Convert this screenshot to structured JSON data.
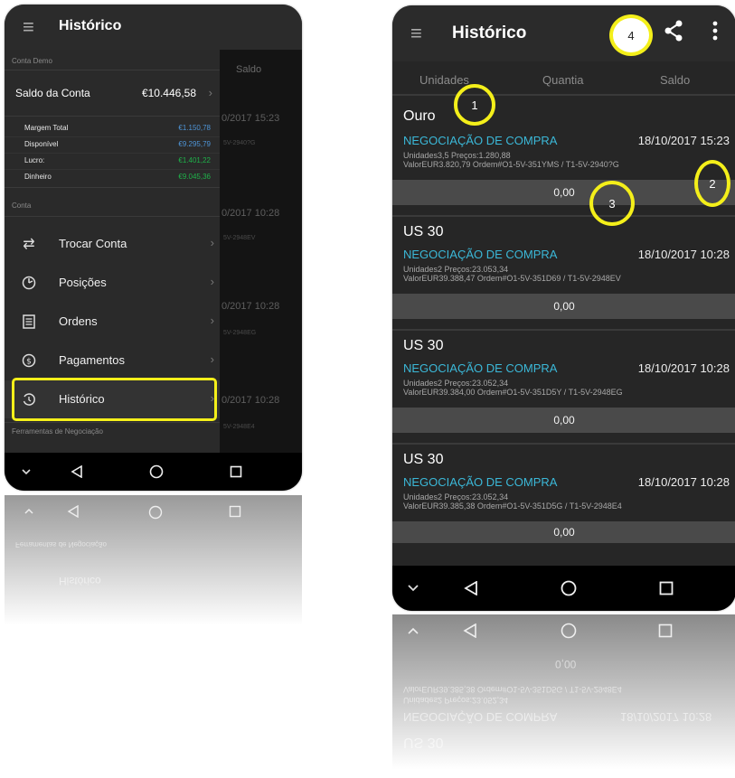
{
  "colors": {
    "accent_cyan": "#3bb8d8",
    "margin_blue": "#4e94d6",
    "green_value": "#1fb24a",
    "highlight_yellow": "#f4ef1a"
  },
  "left_phone": {
    "title": "Histórico",
    "section_demo": "Conta Demo",
    "background_header": "Saldo",
    "background_dates": [
      "0/2017 15:23",
      "0/2017 10:28",
      "0/2017 10:28",
      "0/2017 10:28"
    ],
    "background_codes": [
      "5V-2940?G",
      "5V-2948EV",
      "5V-2948EG",
      "5V-2948E4"
    ],
    "balance_label": "Saldo da Conta",
    "balance_value": "€10.446,58",
    "stats": [
      {
        "label": "Margem Total",
        "value": "€1.150,78"
      },
      {
        "label": "Disponível",
        "value": "€9.295,79"
      },
      {
        "label": "Lucro:",
        "value": "€1.401,22"
      },
      {
        "label": "Dinheiro",
        "value": "€9.045,36"
      }
    ],
    "section_account": "Conta",
    "menu": [
      {
        "icon": "swap-icon",
        "label": "Trocar Conta"
      },
      {
        "icon": "clock-icon",
        "label": "Posições"
      },
      {
        "icon": "document-icon",
        "label": "Ordens"
      },
      {
        "icon": "dollar-icon",
        "label": "Pagamentos"
      },
      {
        "icon": "history-icon",
        "label": "Histórico"
      }
    ],
    "section_tools": "Ferramentas de Negociação",
    "selected_item": "Histórico"
  },
  "right_phone": {
    "title": "Histórico",
    "columns": [
      "Unidades",
      "Quantia",
      "Saldo"
    ],
    "trades": [
      {
        "instrument": "Ouro",
        "type": "NEGOCIAÇÃO DE COMPRA",
        "date": "18/10/2017 15:23",
        "line1": "Unidades3,5  Preços:1.280,88",
        "line2": "ValorEUR3.820,79  Ordem#O1-5V-351YMS / T1-5V-2940?G",
        "value": "0,00"
      },
      {
        "instrument": "US 30",
        "type": "NEGOCIAÇÃO DE COMPRA",
        "date": "18/10/2017 10:28",
        "line1": "Unidades2  Preços:23.053,34",
        "line2": "ValorEUR39.388,47  Ordem#O1-5V-351D69 / T1-5V-2948EV",
        "value": "0,00"
      },
      {
        "instrument": "US 30",
        "type": "NEGOCIAÇÃO DE COMPRA",
        "date": "18/10/2017 10:28",
        "line1": "Unidades2  Preços:23.052,34",
        "line2": "ValorEUR39.384,00  Ordem#O1-5V-351D5Y / T1-5V-2948EG",
        "value": "0,00"
      },
      {
        "instrument": "US 30",
        "type": "NEGOCIAÇÃO DE COMPRA",
        "date": "18/10/2017 10:28",
        "line1": "Unidades2  Preços:23.052,34",
        "line2": "ValorEUR39.385,38  Ordem#O1-5V-351D5G / T1-5V-2948E4",
        "value": "0,00"
      }
    ],
    "callouts": [
      "1",
      "2",
      "3",
      "4"
    ]
  },
  "reflection": {
    "left_texts": [
      "Ferramentas de Negociação",
      "Histórico"
    ],
    "right_texts": [
      "0,00",
      "ValorEUR39.385,38  Ordem#O1-5V-351D5G / T1-5V-2948E4",
      "Unidades2  Preços:23.052,34",
      "NEGOCIAÇÃO DE COMPRA",
      "18/10/2017 10:28",
      "US 30"
    ]
  }
}
